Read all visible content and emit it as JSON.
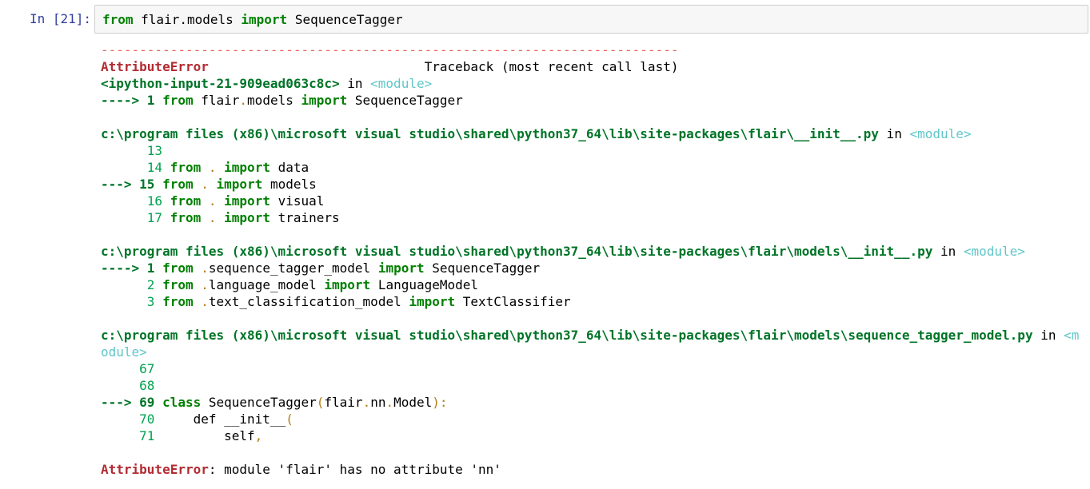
{
  "cell": {
    "prompt": "In [21]:",
    "input": {
      "kw_from": "from",
      "module": " flair.models ",
      "kw_import": "import",
      "name": " SequenceTagger"
    }
  },
  "traceback": {
    "separator": "---------------------------------------------------------------------------",
    "error_name": "AttributeError",
    "header_right": "Traceback (most recent call last)",
    "frames": [
      {
        "file": "<ipython-input-21-909ead063c8c>",
        "in_word": " in ",
        "module_tag": "<module>",
        "lines": [
          {
            "arrow": "----> ",
            "num": "1",
            "code": [
              {
                "t": " "
              },
              {
                "t": "from",
                "c": "kw"
              },
              {
                "t": " flair"
              },
              {
                "t": ".",
                "c": "dot"
              },
              {
                "t": "models "
              },
              {
                "t": "import",
                "c": "kw"
              },
              {
                "t": " SequenceTagger"
              }
            ]
          }
        ]
      },
      {
        "file": "c:\\program files (x86)\\microsoft visual studio\\shared\\python37_64\\lib\\site-packages\\flair\\__init__.py",
        "in_word": " in ",
        "module_tag": "<module>",
        "lines": [
          {
            "arrow": "      ",
            "num": "13",
            "code": []
          },
          {
            "arrow": "      ",
            "num": "14",
            "code": [
              {
                "t": " "
              },
              {
                "t": "from",
                "c": "kw"
              },
              {
                "t": " "
              },
              {
                "t": ".",
                "c": "dot"
              },
              {
                "t": " "
              },
              {
                "t": "import",
                "c": "kw"
              },
              {
                "t": " data"
              }
            ]
          },
          {
            "arrow": "---> ",
            "num": "15",
            "code": [
              {
                "t": " "
              },
              {
                "t": "from",
                "c": "kw"
              },
              {
                "t": " "
              },
              {
                "t": ".",
                "c": "dot"
              },
              {
                "t": " "
              },
              {
                "t": "import",
                "c": "kw"
              },
              {
                "t": " models"
              }
            ]
          },
          {
            "arrow": "      ",
            "num": "16",
            "code": [
              {
                "t": " "
              },
              {
                "t": "from",
                "c": "kw"
              },
              {
                "t": " "
              },
              {
                "t": ".",
                "c": "dot"
              },
              {
                "t": " "
              },
              {
                "t": "import",
                "c": "kw"
              },
              {
                "t": " visual"
              }
            ]
          },
          {
            "arrow": "      ",
            "num": "17",
            "code": [
              {
                "t": " "
              },
              {
                "t": "from",
                "c": "kw"
              },
              {
                "t": " "
              },
              {
                "t": ".",
                "c": "dot"
              },
              {
                "t": " "
              },
              {
                "t": "import",
                "c": "kw"
              },
              {
                "t": " trainers"
              }
            ]
          }
        ]
      },
      {
        "file": "c:\\program files (x86)\\microsoft visual studio\\shared\\python37_64\\lib\\site-packages\\flair\\models\\__init__.py",
        "in_word": " in ",
        "module_tag": "<module>",
        "lines": [
          {
            "arrow": "----> ",
            "num": "1",
            "code": [
              {
                "t": " "
              },
              {
                "t": "from",
                "c": "kw"
              },
              {
                "t": " "
              },
              {
                "t": ".",
                "c": "dot"
              },
              {
                "t": "sequence_tagger_model "
              },
              {
                "t": "import",
                "c": "kw"
              },
              {
                "t": " SequenceTagger"
              }
            ]
          },
          {
            "arrow": "      ",
            "num": "2",
            "code": [
              {
                "t": " "
              },
              {
                "t": "from",
                "c": "kw"
              },
              {
                "t": " "
              },
              {
                "t": ".",
                "c": "dot"
              },
              {
                "t": "language_model "
              },
              {
                "t": "import",
                "c": "kw"
              },
              {
                "t": " LanguageModel"
              }
            ]
          },
          {
            "arrow": "      ",
            "num": "3",
            "code": [
              {
                "t": " "
              },
              {
                "t": "from",
                "c": "kw"
              },
              {
                "t": " "
              },
              {
                "t": ".",
                "c": "dot"
              },
              {
                "t": "text_classification_model "
              },
              {
                "t": "import",
                "c": "kw"
              },
              {
                "t": " TextClassifier"
              }
            ]
          }
        ]
      },
      {
        "file": "c:\\program files (x86)\\microsoft visual studio\\shared\\python37_64\\lib\\site-packages\\flair\\models\\sequence_tagger_model.py",
        "in_word": " in ",
        "module_tag": "<m\nodule>",
        "lines": [
          {
            "arrow": "     ",
            "num": "67",
            "code": []
          },
          {
            "arrow": "     ",
            "num": "68",
            "code": []
          },
          {
            "arrow": "---> ",
            "num": "69",
            "code": [
              {
                "t": " "
              },
              {
                "t": "class",
                "c": "kw"
              },
              {
                "t": " SequenceTagger"
              },
              {
                "t": "(",
                "c": "dot"
              },
              {
                "t": "flair"
              },
              {
                "t": ".",
                "c": "dot"
              },
              {
                "t": "nn"
              },
              {
                "t": ".",
                "c": "dot"
              },
              {
                "t": "Model"
              },
              {
                "t": "):",
                "c": "dot"
              }
            ]
          },
          {
            "arrow": "     ",
            "num": "70",
            "code": [
              {
                "t": "     def __init__"
              },
              {
                "t": "(",
                "c": "dot"
              }
            ]
          },
          {
            "arrow": "     ",
            "num": "71",
            "code": [
              {
                "t": "         self"
              },
              {
                "t": ",",
                "c": "dot"
              }
            ]
          }
        ]
      }
    ],
    "final_error_name": "AttributeError",
    "final_message": ": module 'flair' has no attribute 'nn'"
  }
}
